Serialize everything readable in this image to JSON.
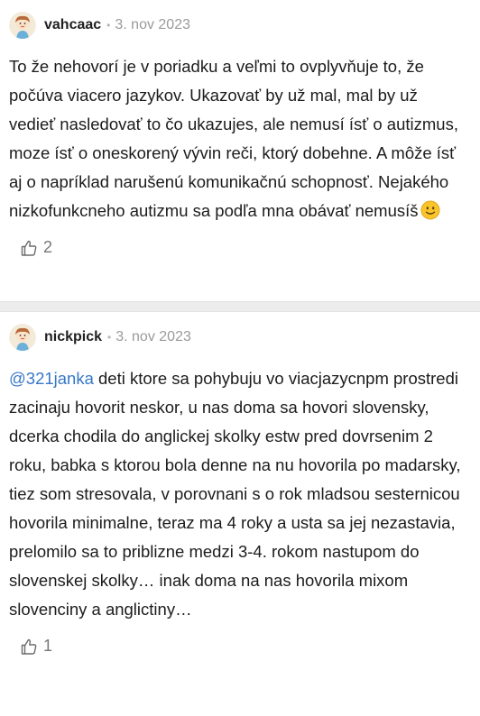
{
  "comments": [
    {
      "username": "vahcaac",
      "separator": "•",
      "date": "3. nov 2023",
      "text": "To že nehovorí je v poriadku a veľmi to ovplyvňuje to, že počúva viacero jazykov. Ukazovať by už mal, mal by už vedieť nasledovať to čo ukazujes, ale nemusí ísť o autizmus, moze ísť o oneskorený vývin reči, ktorý dobehne. A môže ísť aj o napríklad narušenú komunikačnú schopnosť. Nejakého nizkofunkcneho autizmu sa podľa mna obávať nemusíš",
      "emoji": "slightly-smiling-face",
      "likes": "2"
    },
    {
      "username": "nickpick",
      "separator": "•",
      "date": "3. nov 2023",
      "mention": "@321janka",
      "text": " deti ktore sa pohybuju vo viacjazycnpm prostredi zacinaju hovorit neskor, u nas doma sa hovori slovensky, dcerka chodila do anglickej skolky estw pred dovrsenim 2 roku, babka s ktorou bola denne na nu hovorila po madarsky, tiez som stresovala, v porovnani s o rok mladsou sesternicou hovorila minimalne, teraz ma 4 roky a usta sa jej nezastavia, prelomilo sa to priblizne medzi 3-4. rokom nastupom do slovenskej skolky… inak doma na nas hovorila mixom slovenciny a anglictiny…",
      "likes": "1"
    }
  ],
  "colors": {
    "mention": "#3778c7",
    "divider": "#ececec",
    "meta": "#9a9a9a"
  }
}
